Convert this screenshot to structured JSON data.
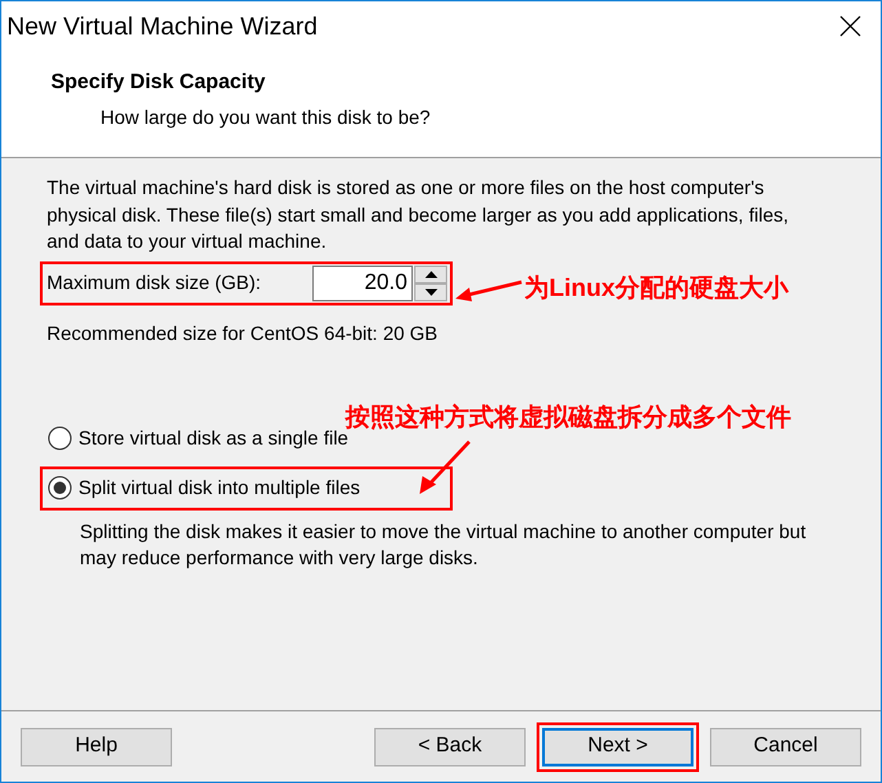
{
  "window": {
    "title": "New Virtual Machine Wizard"
  },
  "header": {
    "title": "Specify Disk Capacity",
    "subtitle": "How large do you want this disk to be?"
  },
  "description": "The virtual machine's hard disk is stored as one or more files on the host computer's physical disk. These file(s) start small and become larger as you add applications, files, and data to your virtual machine.",
  "disk_size": {
    "label": "Maximum disk size (GB):",
    "value": "20.0",
    "highlighted": true
  },
  "recommendation": "Recommended size for CentOS 64-bit: 20 GB",
  "options": [
    {
      "label": "Store virtual disk as a single file",
      "selected": false,
      "highlighted": false
    },
    {
      "label": "Split virtual disk into multiple files",
      "selected": true,
      "highlighted": true
    }
  ],
  "option_description": "Splitting the disk makes it easier to move the virtual machine to another computer but may reduce performance with very large disks.",
  "buttons": [
    {
      "label": "Help",
      "focused": false,
      "highlighted": false
    },
    {
      "label": "< Back",
      "focused": false,
      "highlighted": false
    },
    {
      "label": "Next >",
      "focused": true,
      "highlighted": true
    },
    {
      "label": "Cancel",
      "focused": false,
      "highlighted": false
    }
  ],
  "annotations": [
    "为Linux分配的硬盘大小",
    "按照这种方式将虚拟磁盘拆分成多个文件"
  ]
}
